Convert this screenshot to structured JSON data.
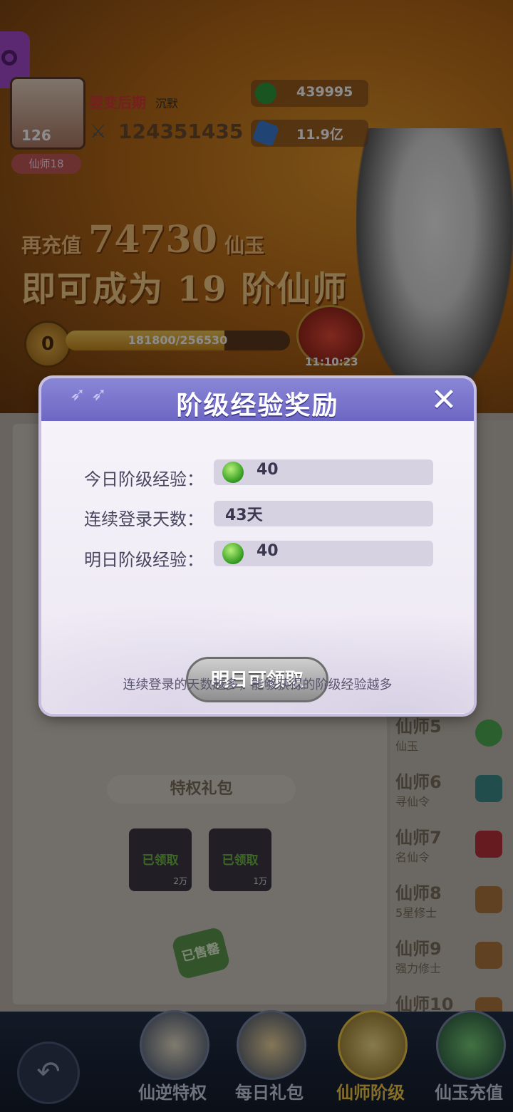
{
  "header": {
    "avatar_level": "126",
    "rank_badge": "仙师18",
    "player_title": "婴变后期",
    "player_status": "沉默",
    "power": "124351435",
    "currency_1": "439995",
    "currency_2": "11.9亿"
  },
  "promo": {
    "line1_prefix": "再充值",
    "line1_amount": "74730",
    "line1_suffix": "仙玉",
    "line2": "即可成为 19 阶仙师"
  },
  "progress": {
    "level": "0",
    "text": "181800/256530",
    "current": 181800,
    "max": 256530,
    "timer": "11:10:23"
  },
  "panel": {
    "gift_title": "特权礼包",
    "gifts": [
      {
        "label": "已领取",
        "amount": "2万"
      },
      {
        "label": "已领取",
        "amount": "1万"
      }
    ],
    "sold_out": "已售罄"
  },
  "tiers": [
    {
      "name": "仙师5",
      "sub": "仙玉"
    },
    {
      "name": "仙师6",
      "sub": "寻仙令"
    },
    {
      "name": "仙师7",
      "sub": "名仙令"
    },
    {
      "name": "仙师8",
      "sub": "5星修士"
    },
    {
      "name": "仙师9",
      "sub": "强力修士"
    },
    {
      "name": "仙师10",
      "sub": ""
    }
  ],
  "nav": [
    {
      "label": "仙逆特权"
    },
    {
      "label": "每日礼包"
    },
    {
      "label": "仙师阶级"
    },
    {
      "label": "仙玉充值"
    }
  ],
  "modal": {
    "title": "阶级经验奖励",
    "rows": [
      {
        "label": "今日阶级经验：",
        "value": "40"
      },
      {
        "label": "连续登录天数：",
        "value": "43天"
      },
      {
        "label": "明日阶级经验：",
        "value": "40"
      }
    ],
    "claim_button": "明日可领取",
    "footer": "连续登录的天数越多，能够获得的阶级经验越多"
  },
  "colors": {
    "modal_header": "#6d67c4",
    "gem": "#2f9a1e",
    "nav_active": "#f3c94a"
  }
}
